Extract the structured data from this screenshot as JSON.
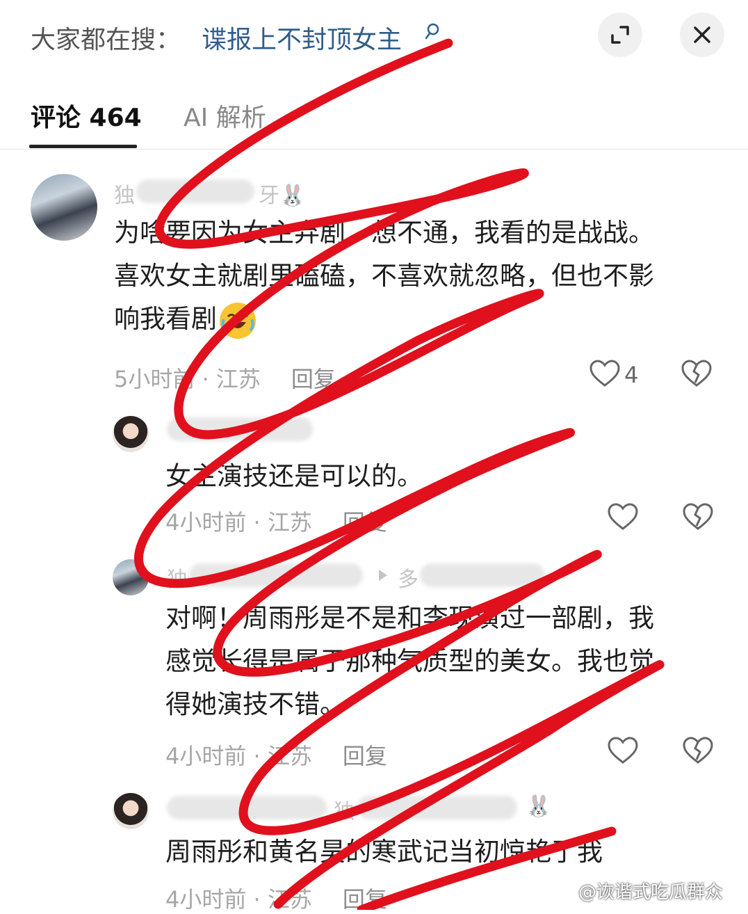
{
  "header": {
    "search_prefix": "大家都在搜：",
    "search_term": "谍报上不封顶女主",
    "icons": {
      "search": "search-icon",
      "expand": "expand-icon",
      "close": "close-icon"
    }
  },
  "tabs": [
    {
      "label": "评论 464",
      "active": true
    },
    {
      "label": "AI 解析",
      "active": false
    }
  ],
  "comments": [
    {
      "username_visible": "独",
      "username_tail": "牙🐰",
      "text_lines": [
        "为啥要因为女主弃剧，想不通，我看的是战战。",
        "喜欢女主就剧里磕磕，不喜欢就忽略，但也不影",
        "响我看剧"
      ],
      "emoji": "laughing-crying-emoji",
      "time": "5小时前",
      "location": "江苏",
      "reply_label": "回复",
      "likes": "4"
    },
    {
      "text_lines": [
        "女主演技还是可以的。"
      ],
      "time": "4小时前",
      "location": "江苏",
      "reply_label": "回复"
    },
    {
      "username_visible": "独",
      "username_tail": "多",
      "text_lines": [
        "对啊！周雨彤是不是和李现演过一部剧，我",
        "感觉长得是属于那种气质型的美女。我也觉",
        "得她演技不错。"
      ],
      "time": "4小时前",
      "location": "江苏",
      "reply_label": "回复"
    },
    {
      "username_tail": "独",
      "username_tail2": "🐰",
      "text_lines": [
        "周雨彤和黄名昊的寒武记当初惊艳了我"
      ],
      "time": "4小时前",
      "location": "江苏",
      "reply_label": "回复"
    }
  ],
  "watermark": "@诙谐式吃瓜群众",
  "colors": {
    "search_term": "#2f5c8a",
    "scribble": "#e0101d",
    "meta": "#a6a6a6"
  }
}
